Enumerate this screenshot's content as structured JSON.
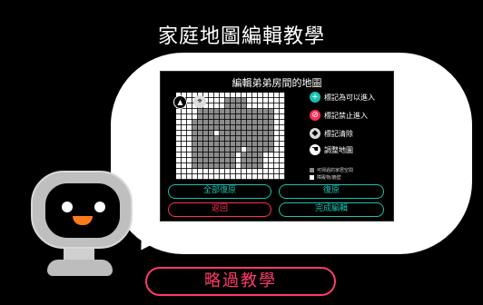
{
  "page": {
    "title": "家庭地圖編輯教學"
  },
  "panel": {
    "title": "編輯弟弟房間的地圖",
    "legend": [
      {
        "icon": "plus-icon",
        "label": "標記為可以進入",
        "color": "#19c2b0"
      },
      {
        "icon": "no-entry-icon",
        "label": "標記禁止進入",
        "color": "#ff2d55"
      },
      {
        "icon": "eraser-icon",
        "label": "標記清除",
        "color": "#d9d9d9"
      },
      {
        "icon": "hand-icon",
        "label": "調整地圖",
        "color": "#ffffff"
      }
    ],
    "notes": [
      "可掃過的家居空間",
      "障礙物/牆壁"
    ],
    "buttons": {
      "restore_all": "全部復原",
      "restore": "復原",
      "back": "返回",
      "finish": "完成編輯"
    }
  },
  "skip_label": "略過教學",
  "colors": {
    "accent_teal": "#19c2b0",
    "accent_red": "#ff2d55",
    "skip_red": "#ff3b6b"
  }
}
